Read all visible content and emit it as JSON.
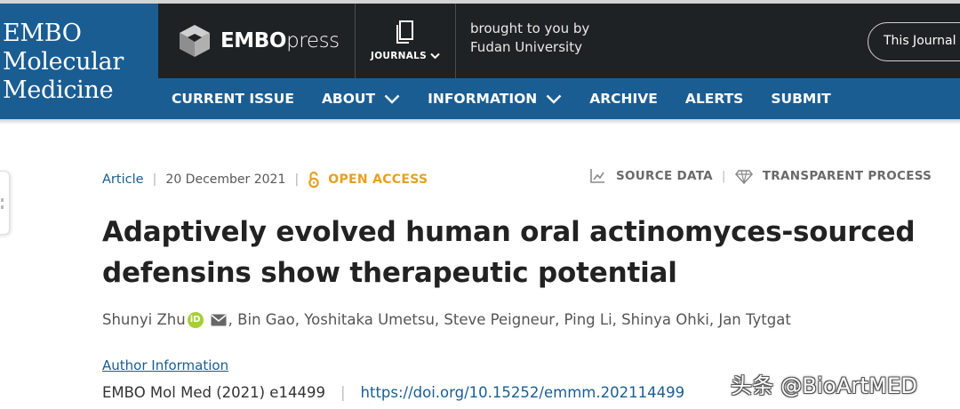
{
  "brand": {
    "lines": [
      "EMBO",
      "Molecular",
      "Medicine"
    ]
  },
  "publisher": {
    "bold": "EMBO",
    "light": "press"
  },
  "journals": {
    "label": "JOURNALS"
  },
  "sponsor": {
    "line1": "brought to you by",
    "line2": "Fudan University"
  },
  "search_scope": {
    "label": "This Journal"
  },
  "nav": {
    "items": [
      {
        "label": "CURRENT ISSUE",
        "dropdown": false
      },
      {
        "label": "ABOUT",
        "dropdown": true
      },
      {
        "label": "INFORMATION",
        "dropdown": true
      },
      {
        "label": "ARCHIVE",
        "dropdown": false
      },
      {
        "label": "ALERTS",
        "dropdown": false
      },
      {
        "label": "SUBMIT",
        "dropdown": false
      }
    ]
  },
  "article": {
    "type": "Article",
    "date": "20 December 2021",
    "access": "OPEN ACCESS",
    "source_data": "SOURCE DATA",
    "transparent_process": "TRANSPARENT PROCESS",
    "title_line1": "Adaptively evolved human oral actinomyces-sourced",
    "title_line2": "defensins show therapeutic potential",
    "first_author": "Shunyi Zhu",
    "orcid_badge": "iD",
    "other_authors": ", Bin Gao, Yoshitaka Umetsu, Steve Peigneur, Ping Li, Shinya Ohki, Jan Tytgat",
    "author_info": "Author Information",
    "citation": "EMBO Mol Med (2021) e14499",
    "doi": "https://doi.org/10.15252/emmm.202114499"
  },
  "watermark": {
    "text": "头条 @BioArtMED"
  },
  "colors": {
    "brand_blue": "#1a5d93",
    "header_dark": "#1f2224",
    "open_access": "#e8a01f",
    "orcid": "#a6ce39"
  }
}
